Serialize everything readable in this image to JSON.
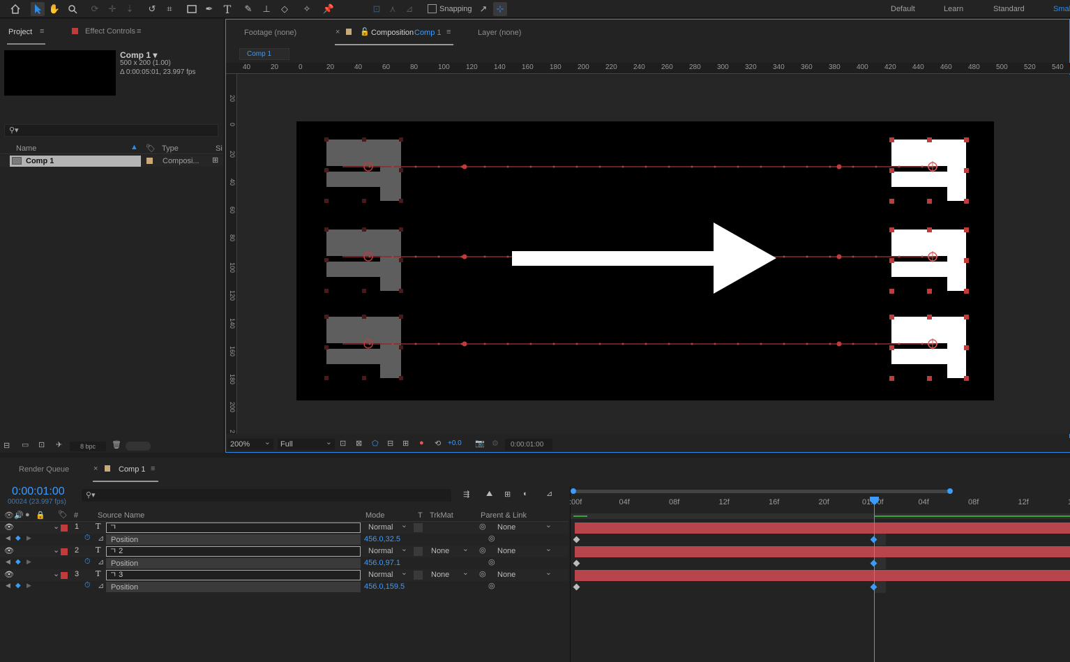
{
  "toolbar": {
    "tools": [
      "home-icon",
      "selection-icon",
      "hand-icon",
      "zoom-icon",
      "orbit-icon",
      "pan-behind-icon",
      "dolly-icon",
      "rotate-icon",
      "anchor-icon",
      "rectangle-icon",
      "pen-icon",
      "type-icon",
      "brush-icon",
      "stamp-icon",
      "eraser-icon",
      "roto-icon",
      "puppet-icon"
    ],
    "snapping_label": "Snapping",
    "workspaces": [
      "Default",
      "Learn",
      "Standard",
      "Small"
    ],
    "active_workspace": "Small",
    "accent": "#2d8ceb"
  },
  "project_panel": {
    "tab_project": "Project",
    "tab_effect": "Effect Controls",
    "comp_name": "Comp 1 ▾",
    "comp_size": "500 x 200 (1.00)",
    "comp_duration": "Δ 0:00:05:01, 23.997 fps",
    "search_placeholder": "",
    "columns": {
      "name": "Name",
      "type": "Type",
      "size": "Si"
    },
    "item_name": "Comp 1",
    "item_type": "Composi...",
    "bpc": "8 bpc"
  },
  "viewer": {
    "tab_footage": "Footage  (none)",
    "tab_comp_prefix": "Composition",
    "tab_comp_name": "Comp 1",
    "tab_layer": "Layer  (none)",
    "breadcrumb": "Comp 1",
    "ruler_h": [
      "40",
      "20",
      "0",
      "20",
      "40",
      "60",
      "80",
      "100",
      "120",
      "140",
      "160",
      "180",
      "200",
      "220",
      "240",
      "260",
      "280",
      "300",
      "320",
      "340",
      "360",
      "380",
      "400",
      "420",
      "440",
      "460",
      "480",
      "500",
      "520",
      "540"
    ],
    "ruler_v": [
      "20",
      "0",
      "20",
      "40",
      "60",
      "80",
      "100",
      "120",
      "140",
      "160",
      "180",
      "200",
      "2"
    ],
    "zoom": "200%",
    "resolution": "Full",
    "exposure": "+0.0",
    "timecode": "0:00:01:00",
    "glyph": "ㄱ"
  },
  "timeline": {
    "tab_render": "Render Queue",
    "tab_comp": "Comp 1",
    "timecode": "0:00:01:00",
    "frames": "00024 (23.997 fps)",
    "col_headers": {
      "num": "#",
      "source": "Source Name",
      "mode": "Mode",
      "t": "T",
      "trkmat": "TrkMat",
      "parent": "Parent & Link"
    },
    "layers": [
      {
        "num": "1",
        "type": "T",
        "name": "ㄱ",
        "mode": "Normal",
        "trkmat": "",
        "parent": "None",
        "prop": "Position",
        "value": "456.0,32.5",
        "color": "#c23b3b"
      },
      {
        "num": "2",
        "type": "T",
        "name": "ㄱ 2",
        "mode": "Normal",
        "trkmat": "None",
        "parent": "None",
        "prop": "Position",
        "value": "456.0,97.1",
        "color": "#c23b3b"
      },
      {
        "num": "3",
        "type": "T",
        "name": "ㄱ 3",
        "mode": "Normal",
        "trkmat": "None",
        "parent": "None",
        "prop": "Position",
        "value": "456.0,159.5",
        "color": "#c23b3b"
      }
    ],
    "ruler": [
      ":00f",
      "04f",
      "08f",
      "12f",
      "16f",
      "20f",
      "01:00f",
      "04f",
      "08f",
      "12f",
      "1"
    ]
  }
}
